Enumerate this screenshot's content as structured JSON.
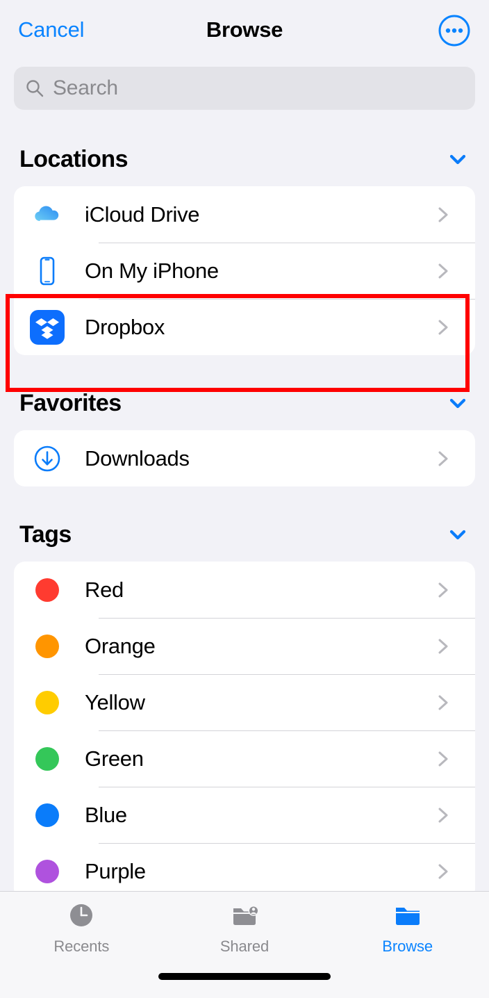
{
  "navbar": {
    "cancel_label": "Cancel",
    "title": "Browse",
    "more_icon": "ellipsis-circle-icon"
  },
  "search": {
    "placeholder": "Search",
    "value": "",
    "icon": "search-icon"
  },
  "sections": [
    {
      "title": "Locations",
      "collapse_icon": "chevron-down-icon",
      "rows": [
        {
          "label": "iCloud Drive",
          "icon": "icloud-drive-icon",
          "chevron": "chevron-right-icon"
        },
        {
          "label": "On My iPhone",
          "icon": "iphone-icon",
          "chevron": "chevron-right-icon"
        },
        {
          "label": "Dropbox",
          "icon": "dropbox-icon",
          "chevron": "chevron-right-icon"
        }
      ]
    },
    {
      "title": "Favorites",
      "collapse_icon": "chevron-down-icon",
      "rows": [
        {
          "label": "Downloads",
          "icon": "download-circle-icon",
          "chevron": "chevron-right-icon"
        }
      ]
    },
    {
      "title": "Tags",
      "collapse_icon": "chevron-down-icon",
      "rows": [
        {
          "label": "Red",
          "icon": "tag-dot-icon",
          "color": "#ff3b30",
          "chevron": "chevron-right-icon"
        },
        {
          "label": "Orange",
          "icon": "tag-dot-icon",
          "color": "#ff9500",
          "chevron": "chevron-right-icon"
        },
        {
          "label": "Yellow",
          "icon": "tag-dot-icon",
          "color": "#ffcc00",
          "chevron": "chevron-right-icon"
        },
        {
          "label": "Green",
          "icon": "tag-dot-icon",
          "color": "#34c759",
          "chevron": "chevron-right-icon"
        },
        {
          "label": "Blue",
          "icon": "tag-dot-icon",
          "color": "#0a7cfa",
          "chevron": "chevron-right-icon"
        },
        {
          "label": "Purple",
          "icon": "tag-dot-icon",
          "color": "#af52de",
          "chevron": "chevron-right-icon"
        }
      ]
    }
  ],
  "highlight": {
    "target_label": "Dropbox",
    "color": "#ff0000"
  },
  "tabbar": {
    "tabs": [
      {
        "label": "Recents",
        "icon": "clock-icon",
        "active": false
      },
      {
        "label": "Shared",
        "icon": "shared-folder-icon",
        "active": false
      },
      {
        "label": "Browse",
        "icon": "folder-icon",
        "active": true
      }
    ]
  },
  "colors": {
    "accent": "#0a84ff",
    "background": "#f2f2f7",
    "card": "#ffffff",
    "separator": "#d3d3d8",
    "secondary_text": "#8a8a8e",
    "highlight": "#ff0000"
  }
}
